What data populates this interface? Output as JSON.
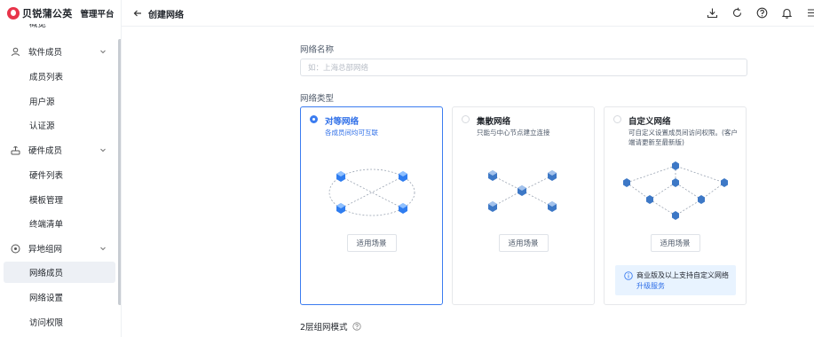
{
  "brand": {
    "name": "贝锐蒲公英",
    "subtitle": "管理平台"
  },
  "sidebar": {
    "partial_item": "概览",
    "items": [
      {
        "label": "软件成员",
        "type": "group",
        "icon": "user-icon"
      },
      {
        "label": "成员列表",
        "type": "sub"
      },
      {
        "label": "用户源",
        "type": "sub"
      },
      {
        "label": "认证源",
        "type": "sub"
      },
      {
        "label": "硬件成员",
        "type": "group",
        "icon": "router-icon"
      },
      {
        "label": "硬件列表",
        "type": "sub"
      },
      {
        "label": "模板管理",
        "type": "sub"
      },
      {
        "label": "终端清单",
        "type": "sub"
      },
      {
        "label": "异地组网",
        "type": "group",
        "icon": "network-icon"
      },
      {
        "label": "网络成员",
        "type": "sub",
        "active": true
      },
      {
        "label": "网络设置",
        "type": "sub"
      },
      {
        "label": "访问权限",
        "type": "sub"
      }
    ]
  },
  "header": {
    "title": "创建网络",
    "icons": [
      "download-icon",
      "refresh-icon",
      "help-icon",
      "bell-icon",
      "menu-icon"
    ]
  },
  "form": {
    "name_label": "网络名称",
    "name_placeholder": "如：上海总部网络",
    "name_value": "",
    "type_label": "网络类型",
    "types": [
      {
        "title": "对等网络",
        "desc": "各成员间均可互联",
        "button": "适用场景",
        "selected": true
      },
      {
        "title": "集散网络",
        "desc": "只能与中心节点建立连接",
        "button": "适用场景",
        "selected": false
      },
      {
        "title": "自定义网络",
        "desc": "可自定义设置成员间访问权限。(客户端请更新至最新版)",
        "button": "适用场景",
        "selected": false
      }
    ],
    "notice_text": "商业版及以上支持自定义网络",
    "notice_link": "升级服务",
    "mode_label": "2层组网模式"
  },
  "colors": {
    "accent": "#3b7cf0",
    "brand": "#e8344a",
    "notice_bg": "#e8f3ff",
    "cube": "#2f7df0"
  }
}
